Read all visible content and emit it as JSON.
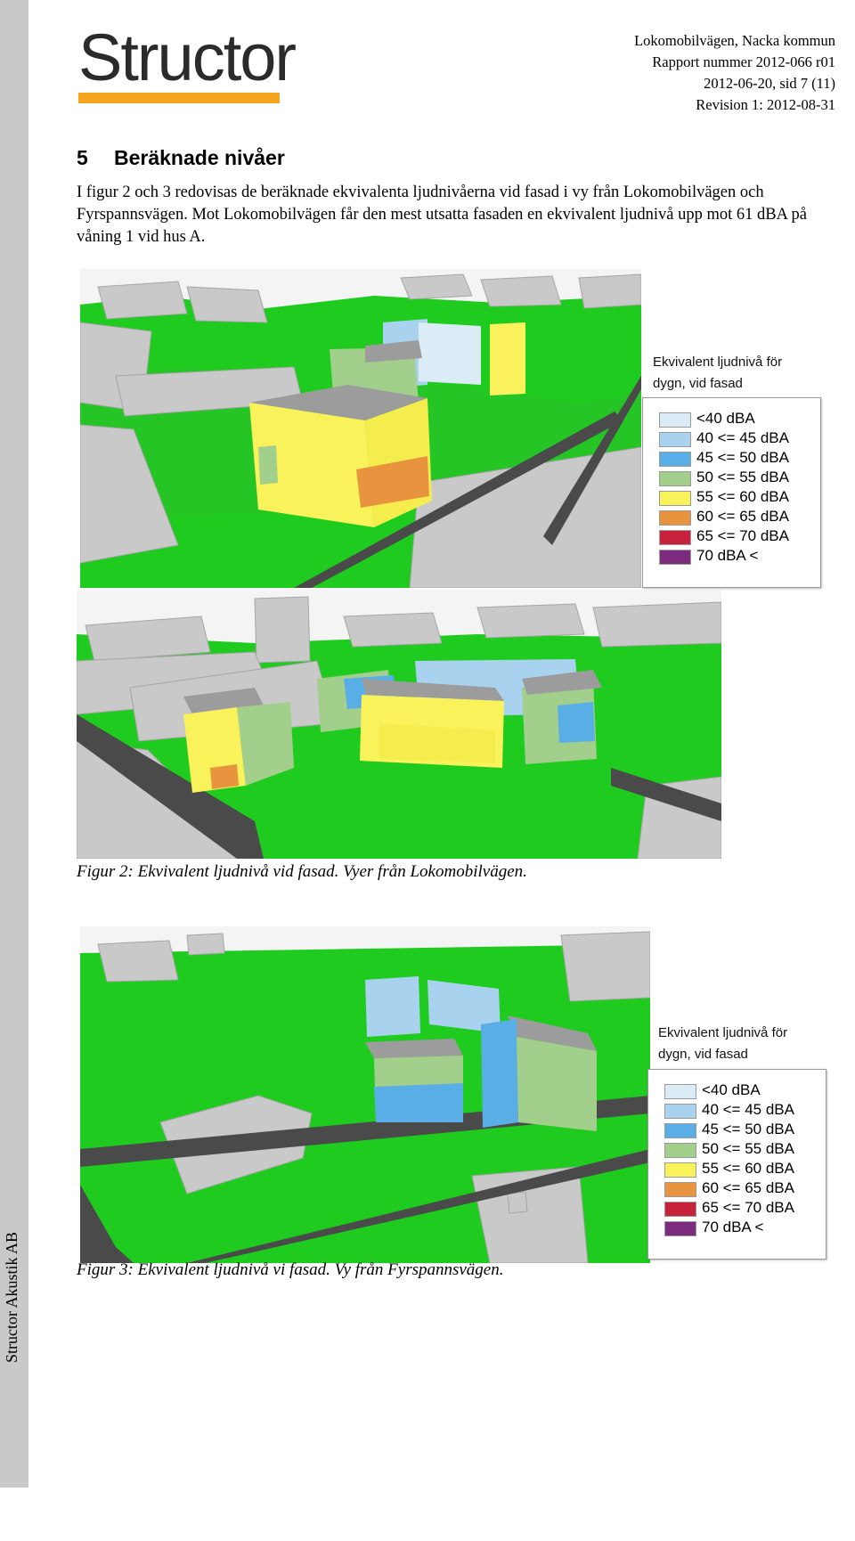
{
  "sidebar": {
    "text": "Structor Akustik AB"
  },
  "logo": {
    "text": "Structor",
    "bar_color": "#f5a51d"
  },
  "header": {
    "line1": "Lokomobilvägen, Nacka kommun",
    "line2": "Rapport nummer 2012-066 r01",
    "line3": "2012-06-20, sid 7 (11)",
    "line4": "Revision 1: 2012-08-31"
  },
  "section": {
    "number": "5",
    "title": "Beräknade nivåer",
    "body": "I figur 2 och 3 redovisas de beräknade ekvivalenta ljudnivåerna vid fasad i vy från Lokomobilvägen och Fyrspannsvägen. Mot Lokomobilvägen får den mest utsatta fasaden en ekvivalent ljudnivå upp mot 61 dBA på våning 1 vid hus A."
  },
  "legend": {
    "title_line1": "Ekvivalent ljudnivå för",
    "title_line2": "dygn, vid fasad",
    "items": [
      {
        "label": "<40 dBA",
        "color": "#dcecf6"
      },
      {
        "label": "40 <= 45 dBA",
        "color": "#a9d2ee"
      },
      {
        "label": "45 <= 50 dBA",
        "color": "#5aaee6"
      },
      {
        "label": "50 <= 55 dBA",
        "color": "#a2cf8c"
      },
      {
        "label": "55 <= 60 dBA",
        "color": "#f9f25a"
      },
      {
        "label": "60 <= 65 dBA",
        "color": "#e8933e"
      },
      {
        "label": "65 <= 70 dBA",
        "color": "#c8213b"
      },
      {
        "label": "70 dBA <",
        "color": "#7b2a7e"
      }
    ]
  },
  "figure2": {
    "caption": "Figur 2: Ekvivalent ljudnivå vid fasad. Vyer från Lokomobilvägen."
  },
  "figure3": {
    "caption": "Figur 3: Ekvivalent ljudnivå vi fasad. Vy från Fyrspannsvägen."
  },
  "colors": {
    "grass": "#1ecb1e",
    "road": "#4a4a4a",
    "building_roof": "#9c9c9c",
    "building_wall": "#c8c8c8"
  }
}
